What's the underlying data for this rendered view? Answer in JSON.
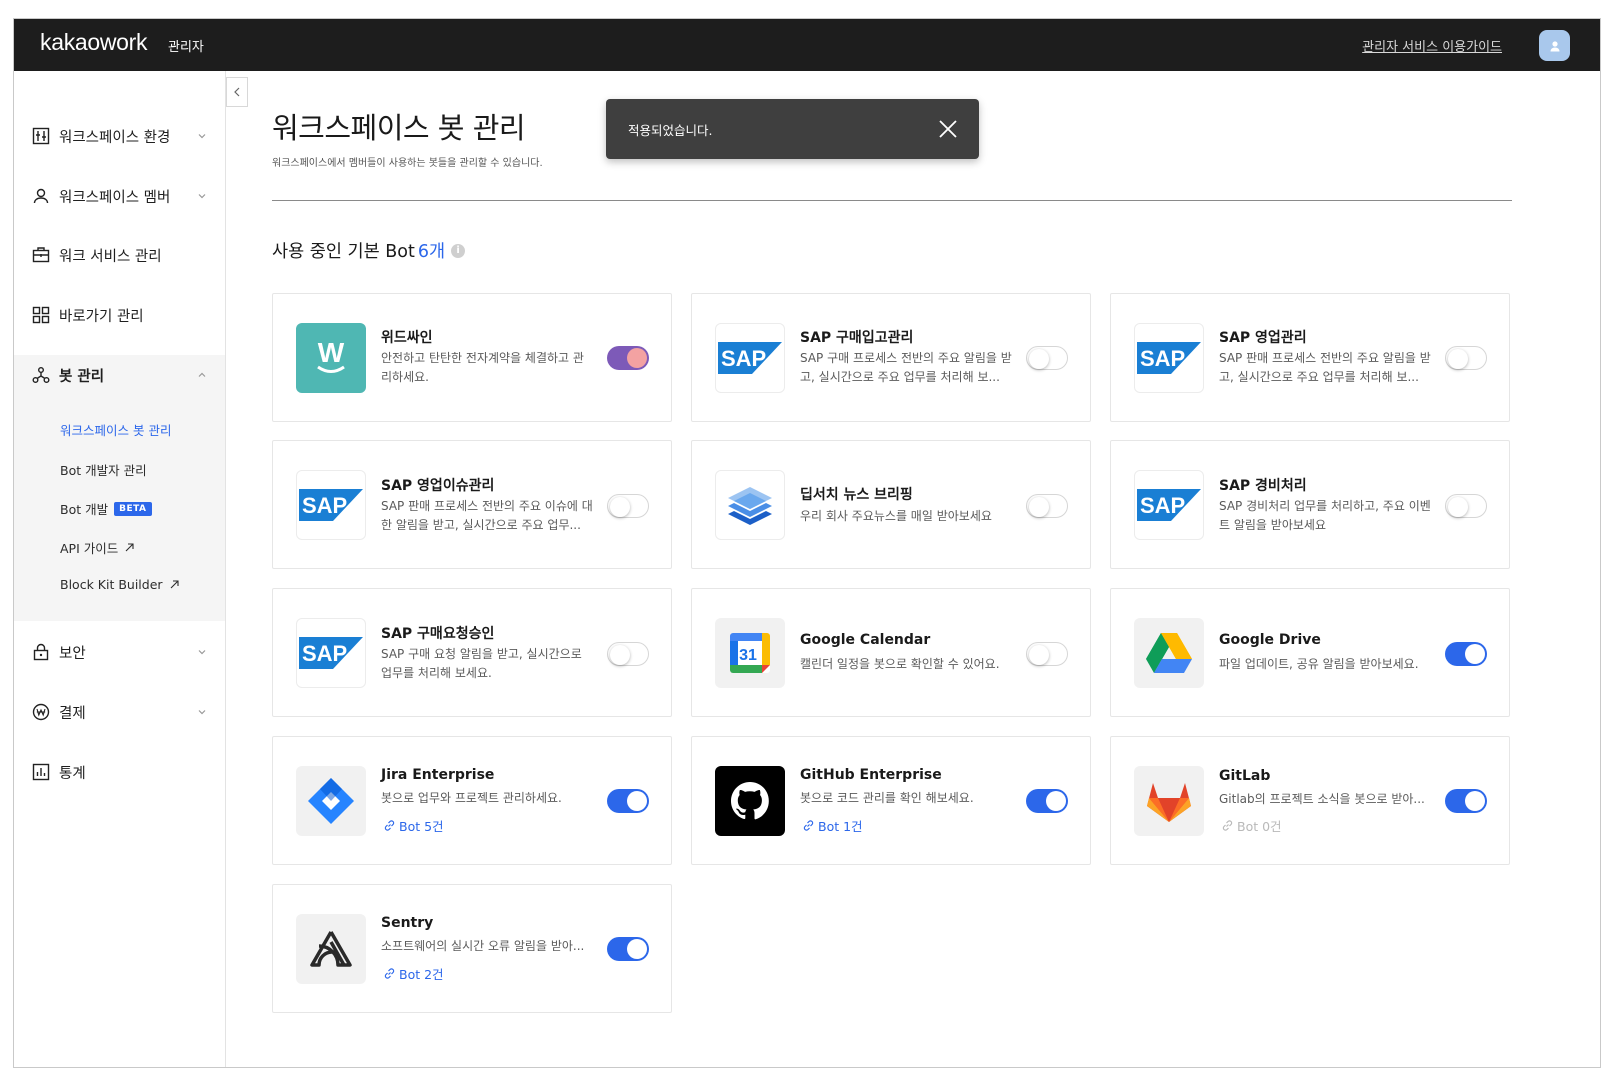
{
  "header": {
    "logo": "kakaowork",
    "admin_label": "관리자",
    "guide_link": "관리자 서비스 이용가이드"
  },
  "sidebar": {
    "items": [
      {
        "label": "워크스페이스 환경",
        "icon": "workspace-settings-icon",
        "expandable": true
      },
      {
        "label": "워크스페이스 멤버",
        "icon": "person-icon",
        "expandable": true
      },
      {
        "label": "워크 서비스 관리",
        "icon": "briefcase-icon",
        "expandable": false
      },
      {
        "label": "바로가기 관리",
        "icon": "grid-icon",
        "expandable": false
      },
      {
        "label": "봇 관리",
        "icon": "bot-nodes-icon",
        "expandable": true,
        "expanded": true
      },
      {
        "label": "보안",
        "icon": "lock-icon",
        "expandable": true
      },
      {
        "label": "결제",
        "icon": "won-icon",
        "expandable": true
      },
      {
        "label": "통계",
        "icon": "chart-icon",
        "expandable": false
      }
    ],
    "sub_items": [
      {
        "label": "워크스페이스 봇 관리",
        "active": true
      },
      {
        "label": "Bot 개발자 관리"
      },
      {
        "label": "Bot 개발",
        "badge": "BETA"
      },
      {
        "label": "API 가이드",
        "external": true
      },
      {
        "label": "Block Kit Builder",
        "external": true
      }
    ]
  },
  "page": {
    "title": "워크스페이스 봇 관리",
    "description": "워크스페이스에서 멤버들이 사용하는 봇들을 관리할 수 있습니다.",
    "section_title": "사용 중인 기본 Bot",
    "section_count": "6개",
    "info_icon": "i"
  },
  "toast": {
    "message": "적용되었습니다."
  },
  "colors": {
    "accent": "#2c67ea",
    "topbar": "#1d1d1d",
    "toggle_on": "#2c67ea"
  },
  "bots": [
    {
      "name": "위드싸인",
      "desc": "안전하고 탄탄한 전자계약을 체결하고 관리하세요.",
      "logo": "widsign-logo",
      "enabled": true
    },
    {
      "name": "SAP 구매입고관리",
      "desc": "SAP 구매 프로세스 전반의 주요 알림을 받고, 실시간으로 주요 업무를 처리해 보...",
      "logo": "sap-logo",
      "enabled": false
    },
    {
      "name": "SAP 영업관리",
      "desc": "SAP 판매 프로세스 전반의 주요 알림을 받고, 실시간으로 주요 업무를 처리해 보...",
      "logo": "sap-logo",
      "enabled": false
    },
    {
      "name": "SAP 영업이슈관리",
      "desc": "SAP 판매 프로세스 전반의 주요 이슈에 대한 알림을 받고, 실시간으로 주요 업무...",
      "logo": "sap-logo",
      "enabled": false
    },
    {
      "name": "딥서치 뉴스 브리핑",
      "desc": "우리 회사 주요뉴스를 매일 받아보세요",
      "logo": "deepsearch-logo",
      "enabled": false
    },
    {
      "name": "SAP 경비처리",
      "desc": "SAP 경비처리 업무를 처리하고, 주요 이벤트 알림을 받아보세요",
      "logo": "sap-logo",
      "enabled": false
    },
    {
      "name": "SAP 구매요청승인",
      "desc": "SAP 구매 요청 알림을 받고, 실시간으로 업무를 처리해 보세요.",
      "logo": "sap-logo",
      "enabled": false
    },
    {
      "name": "Google Calendar",
      "desc": "캘린더 일정을 봇으로 확인할 수 있어요.",
      "logo": "google-calendar-logo",
      "calendar_day": "31",
      "enabled": false
    },
    {
      "name": "Google Drive",
      "desc": "파일 업데이트, 공유 알림을 받아보세요.",
      "logo": "google-drive-logo",
      "enabled": true
    },
    {
      "name": "Jira Enterprise",
      "desc": "봇으로 업무와 프로젝트 관리하세요.",
      "logo": "jira-logo",
      "enabled": true,
      "bot_link": "Bot 5건"
    },
    {
      "name": "GitHub Enterprise",
      "desc": "봇으로 코드 관리를 확인 해보세요.",
      "logo": "github-logo",
      "enabled": true,
      "bot_link": "Bot 1건"
    },
    {
      "name": "GitLab",
      "desc": "Gitlab의 프로젝트 소식을 봇으로 받아...",
      "logo": "gitlab-logo",
      "enabled": true,
      "bot_link": "Bot 0건"
    },
    {
      "name": "Sentry",
      "desc": "소프트웨어의 실시간 오류 알림을 받아...",
      "logo": "sentry-logo",
      "enabled": true,
      "bot_link": "Bot 2건"
    }
  ]
}
